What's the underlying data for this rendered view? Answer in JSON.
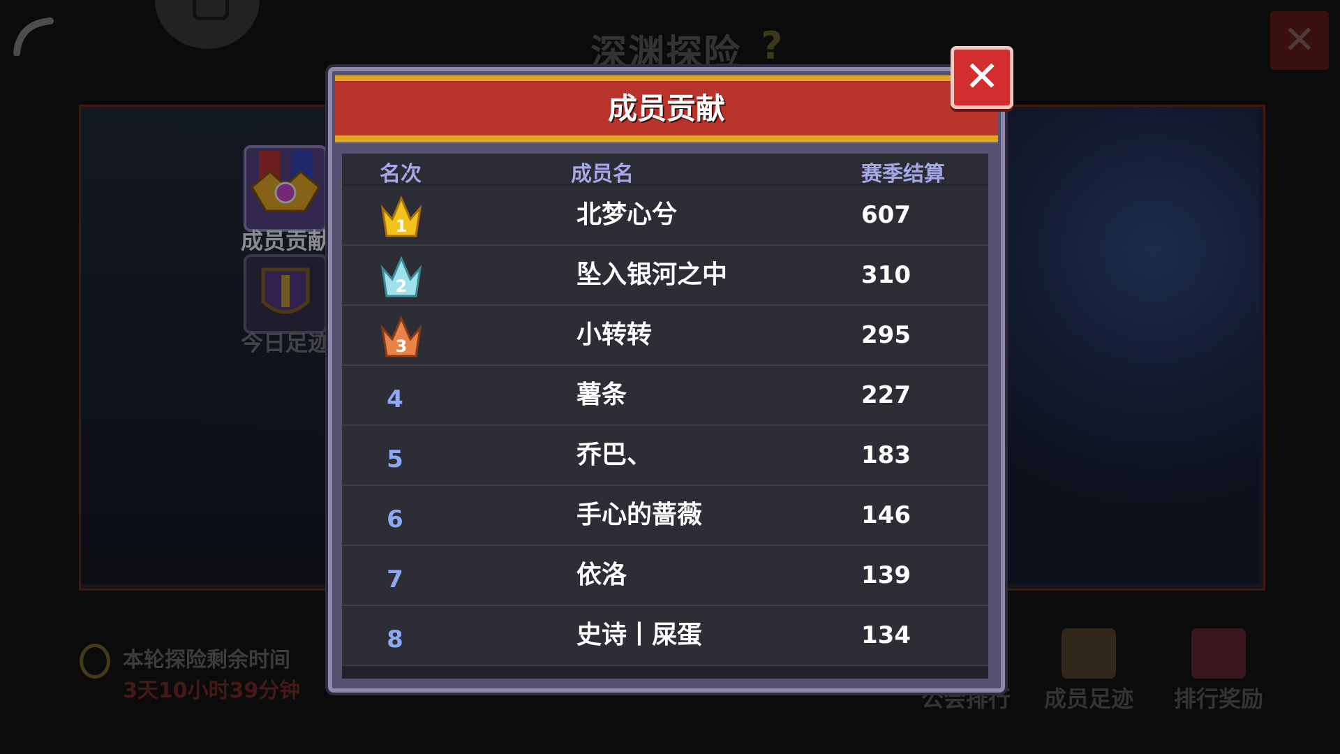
{
  "screen_title": "深渊探险",
  "help_icon": "?",
  "top_close_icon": "✕",
  "side_tabs": [
    {
      "label": "成员贡献",
      "icon": "medal-icon",
      "active": true
    },
    {
      "label": "今日足迹",
      "icon": "shield-icon",
      "active": false
    }
  ],
  "timer": {
    "label": "本轮探险剩余时间",
    "value": "3天10小时39分钟"
  },
  "bottom_nav": [
    {
      "label": "公会排行",
      "icon": "ranking-icon"
    },
    {
      "label": "成员足迹",
      "icon": "cat-icon"
    },
    {
      "label": "排行奖励",
      "icon": "chest-icon"
    }
  ],
  "dialog": {
    "title": "成员贡献",
    "close_icon": "✕",
    "columns": [
      "名次",
      "成员名",
      "赛季结算"
    ],
    "rows": [
      {
        "rank": "1",
        "name": "北梦心兮",
        "score": "607",
        "badge": "gold-crown-icon"
      },
      {
        "rank": "2",
        "name": "坠入银河之中",
        "score": "310",
        "badge": "silver-crown-icon"
      },
      {
        "rank": "3",
        "name": "小转转",
        "score": "295",
        "badge": "bronze-crown-icon"
      },
      {
        "rank": "4",
        "name": "薯条",
        "score": "227"
      },
      {
        "rank": "5",
        "name": "乔巴、",
        "score": "183"
      },
      {
        "rank": "6",
        "name": "手心的蔷薇",
        "score": "146"
      },
      {
        "rank": "7",
        "name": "依洛",
        "score": "139"
      },
      {
        "rank": "8",
        "name": "史诗丨屎蛋",
        "score": "134"
      }
    ]
  },
  "colors": {
    "header_red": "#b8342a",
    "header_gold": "#e0a427",
    "rank_blue": "#8fa8f2",
    "column_header": "#a5a8e4",
    "gold_crown": "#f2c21e",
    "silver_crown": "#9fe0ea",
    "bronze_crown": "#e8844a"
  }
}
